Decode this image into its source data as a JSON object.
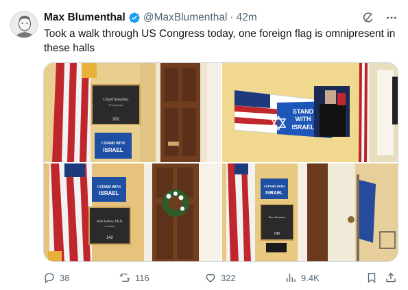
{
  "author": {
    "name": "Max Blumenthal",
    "handle": "@MaxBlumenthal",
    "separator": "·",
    "time": "42m",
    "verified": true
  },
  "tweet_text": "Took a walk through US Congress today, one foreign flag is omnipresent in these halls",
  "images": {
    "img1": {
      "nameplate_title": "Lloyd Smucker",
      "nameplate_small": "Pennsylvania",
      "room": "302",
      "sign_line1": "I STAND WITH",
      "sign_line2": "ISRAEL"
    },
    "img2": {
      "sign_line1": "STAND",
      "sign_line2": "WITH",
      "sign_line3": "ISRAEL"
    },
    "img3": {
      "sign_line1": "I STAND WITH",
      "sign_line2": "ISRAEL",
      "nameplate_title": "Julia Letlow, Ph.D.",
      "nameplate_small": "Louisiana",
      "room": "142"
    },
    "img4": {
      "sign_line1": "I STAND WITH",
      "sign_line2": "ISRAEL",
      "nameplate_title": "Pete Sessions",
      "room": "145"
    }
  },
  "actions": {
    "replies": "38",
    "reposts": "116",
    "likes": "322",
    "views": "9.4K"
  },
  "icons": {
    "verified": "verified-badge-icon",
    "grok": "grok-icon",
    "more": "more-icon",
    "reply": "reply-icon",
    "repost": "repost-icon",
    "like": "heart-icon",
    "views": "views-icon",
    "bookmark": "bookmark-icon",
    "share": "share-icon"
  },
  "colors": {
    "accent": "#1d9bf0",
    "muted": "#536471",
    "text": "#0f1419"
  }
}
